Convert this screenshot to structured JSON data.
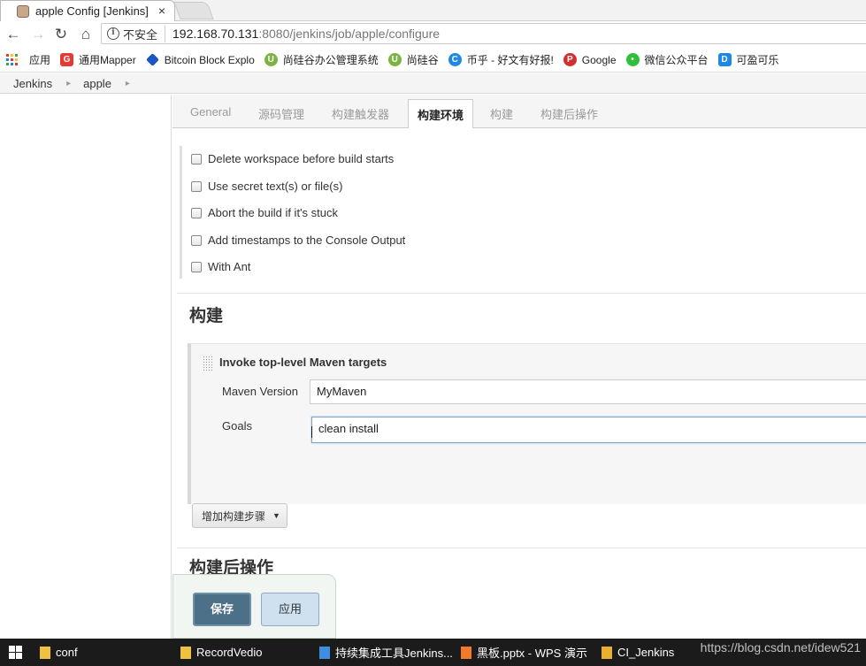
{
  "browser": {
    "tab_title": "apple Config [Jenkins]",
    "close_glyph": "×",
    "security_label": "不安全",
    "url_host": "192.168.70.131",
    "url_rest": ":8080/jenkins/job/apple/configure"
  },
  "bookmarks": [
    {
      "label": "应用",
      "icon": "apps-icon",
      "color": "#4285f4"
    },
    {
      "label": "通用Mapper",
      "icon": "g-icon",
      "color": "#e53935"
    },
    {
      "label": "Bitcoin Block Explo",
      "icon": "diamond-icon",
      "color": "#1a56c4"
    },
    {
      "label": "尚硅谷办公管理系统",
      "icon": "u-icon",
      "color": "#7cb342"
    },
    {
      "label": "尚硅谷",
      "icon": "u-icon",
      "color": "#7cb342"
    },
    {
      "label": "币乎 - 好文有好报!",
      "icon": "c-icon",
      "color": "#1e88e5"
    },
    {
      "label": "Google",
      "icon": "p-icon",
      "color": "#d32f2f"
    },
    {
      "label": "微信公众平台",
      "icon": "wechat-icon",
      "color": "#2fbf3b"
    },
    {
      "label": "可盈可乐",
      "icon": "d-icon",
      "color": "#1e88e5"
    }
  ],
  "breadcrumb": {
    "root": "Jenkins",
    "job": "apple",
    "sep": "▸"
  },
  "config_tabs": [
    "General",
    "源码管理",
    "构建触发器",
    "构建环境",
    "构建",
    "构建后操作"
  ],
  "build_env_options": [
    "Delete workspace before build starts",
    "Use secret text(s) or file(s)",
    "Abort the build if it's stuck",
    "Add timestamps to the Console Output",
    "With Ant"
  ],
  "build_section": {
    "title": "构建",
    "step_title": "Invoke top-level Maven targets",
    "maven_version_label": "Maven Version",
    "maven_version_value": "MyMaven",
    "goals_label": "Goals",
    "goals_value": "clean install",
    "add_step_label": "增加构建步骤"
  },
  "post_build": {
    "title": "构建后操作"
  },
  "actions": {
    "save": "保存",
    "apply": "应用"
  },
  "taskbar": {
    "items": [
      "conf",
      "RecordVedio",
      "持续集成工具Jenkins...",
      "黑板.pptx - WPS 演示",
      "CI_Jenkins"
    ],
    "watermark": "https://blog.csdn.net/idew521"
  },
  "colors": {
    "save_button": "#4d7089",
    "apply_button": "#cfe0ef",
    "taskbar": "#1b1b1b"
  }
}
